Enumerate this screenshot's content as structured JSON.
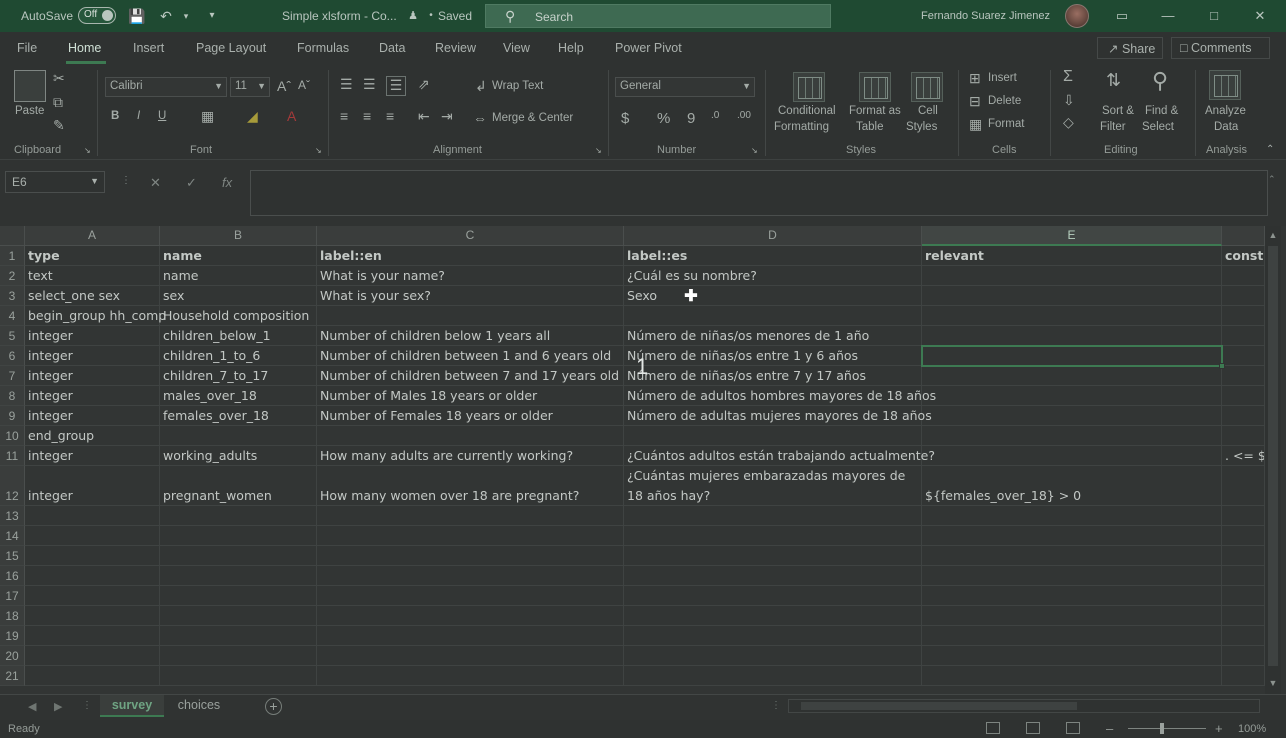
{
  "titlebar": {
    "autosave_label": "AutoSave",
    "autosave_state": "Off",
    "document_title": "Simple xlsform - Co...",
    "saved_status": "Saved",
    "search_placeholder": "Search",
    "user_name": "Fernando Suarez Jimenez"
  },
  "menu": {
    "tabs": [
      "File",
      "Home",
      "Insert",
      "Page Layout",
      "Formulas",
      "Data",
      "Review",
      "View",
      "Help",
      "Power Pivot"
    ],
    "active_tab": "Home",
    "share_label": "Share",
    "comments_label": "Comments"
  },
  "ribbon": {
    "clipboard": {
      "paste_label": "Paste",
      "group_label": "Clipboard"
    },
    "font": {
      "font_name": "Calibri",
      "font_size": "11",
      "bold": "B",
      "italic": "I",
      "underline": "U",
      "group_label": "Font"
    },
    "alignment": {
      "wrap_text_label": "Wrap Text",
      "merge_center_label": "Merge & Center",
      "group_label": "Alignment"
    },
    "number": {
      "format": "General",
      "currency": "$",
      "percent": "%",
      "comma": "9",
      "group_label": "Number"
    },
    "styles": {
      "conditional_formatting": [
        "Conditional",
        "Formatting"
      ],
      "format_as_table": [
        "Format as",
        "Table"
      ],
      "cell_styles": [
        "Cell",
        "Styles"
      ],
      "group_label": "Styles"
    },
    "cells": {
      "insert_label": "Insert",
      "delete_label": "Delete",
      "format_label": "Format",
      "group_label": "Cells"
    },
    "editing": {
      "sort_filter": [
        "Sort &",
        "Filter"
      ],
      "find_select": [
        "Find &",
        "Select"
      ],
      "group_label": "Editing"
    },
    "analysis": {
      "analyze_data": [
        "Analyze",
        "Data"
      ],
      "group_label": "Analysis"
    }
  },
  "formula_bar": {
    "name_box": "E6",
    "fx": "fx",
    "content": ""
  },
  "grid": {
    "columns": [
      "A",
      "B",
      "C",
      "D",
      "E"
    ],
    "selected_column": "E",
    "rows": [
      {
        "n": "1",
        "cells": [
          "type",
          "name",
          "label::en",
          "label::es",
          "relevant",
          "constr"
        ]
      },
      {
        "n": "2",
        "cells": [
          "text",
          "name",
          "What is your name?",
          "¿Cuál es su nombre?",
          "",
          ""
        ]
      },
      {
        "n": "3",
        "cells": [
          "select_one sex",
          "sex",
          "What is your sex?",
          "Sexo",
          "",
          ""
        ]
      },
      {
        "n": "4",
        "cells": [
          "begin_group hh_comp",
          "Household composition",
          "",
          "",
          "",
          ""
        ]
      },
      {
        "n": "5",
        "cells": [
          "integer",
          "children_below_1",
          "Number of children below 1 years all",
          "Número de niñas/os menores de 1 año",
          "",
          ""
        ]
      },
      {
        "n": "6",
        "cells": [
          "integer",
          "children_1_to_6",
          "Number of children between 1 and 6 years old",
          "Número de niñas/os entre 1 y 6 años",
          "",
          ""
        ]
      },
      {
        "n": "7",
        "cells": [
          "integer",
          "children_7_to_17",
          "Number of children between 7 and 17 years old",
          "Número de niñas/os entre 7 y 17 años",
          "",
          ""
        ]
      },
      {
        "n": "8",
        "cells": [
          "integer",
          "males_over_18",
          "Number of Males 18 years or older",
          "Número de adultos hombres mayores de 18 años",
          "",
          ""
        ]
      },
      {
        "n": "9",
        "cells": [
          "integer",
          "females_over_18",
          "Number of Females 18 years or older",
          "Número de adultas mujeres mayores de 18 años",
          "",
          ""
        ]
      },
      {
        "n": "10",
        "cells": [
          "end_group",
          "",
          "",
          "",
          "",
          ""
        ]
      },
      {
        "n": "11",
        "cells": [
          "integer",
          "working_adults",
          "How many adults are currently working?",
          "¿Cuántos adultos están trabajando actualmente?",
          "",
          ". <= ${"
        ]
      },
      {
        "n": "12",
        "cells": [
          "integer",
          "pregnant_women",
          "How many women over 18 are pregnant?",
          "¿Cuántas mujeres embarazadas mayores de 18 años hay?",
          "${females_over_18} > 0",
          ""
        ]
      },
      {
        "n": "13",
        "cells": [
          "",
          "",
          "",
          "",
          "",
          ""
        ]
      },
      {
        "n": "14",
        "cells": [
          "",
          "",
          "",
          "",
          "",
          ""
        ]
      },
      {
        "n": "15",
        "cells": [
          "",
          "",
          "",
          "",
          "",
          ""
        ]
      },
      {
        "n": "16",
        "cells": [
          "",
          "",
          "",
          "",
          "",
          ""
        ]
      },
      {
        "n": "17",
        "cells": [
          "",
          "",
          "",
          "",
          "",
          ""
        ]
      },
      {
        "n": "18",
        "cells": [
          "",
          "",
          "",
          "",
          "",
          ""
        ]
      },
      {
        "n": "19",
        "cells": [
          "",
          "",
          "",
          "",
          "",
          ""
        ]
      },
      {
        "n": "20",
        "cells": [
          "",
          "",
          "",
          "",
          "",
          ""
        ]
      },
      {
        "n": "21",
        "cells": [
          "",
          "",
          "",
          "",
          "",
          ""
        ]
      }
    ],
    "overlay_number": "1"
  },
  "sheets": {
    "tabs": [
      "survey",
      "choices"
    ],
    "active": "survey"
  },
  "status": {
    "ready": "Ready",
    "zoom": "100%"
  }
}
